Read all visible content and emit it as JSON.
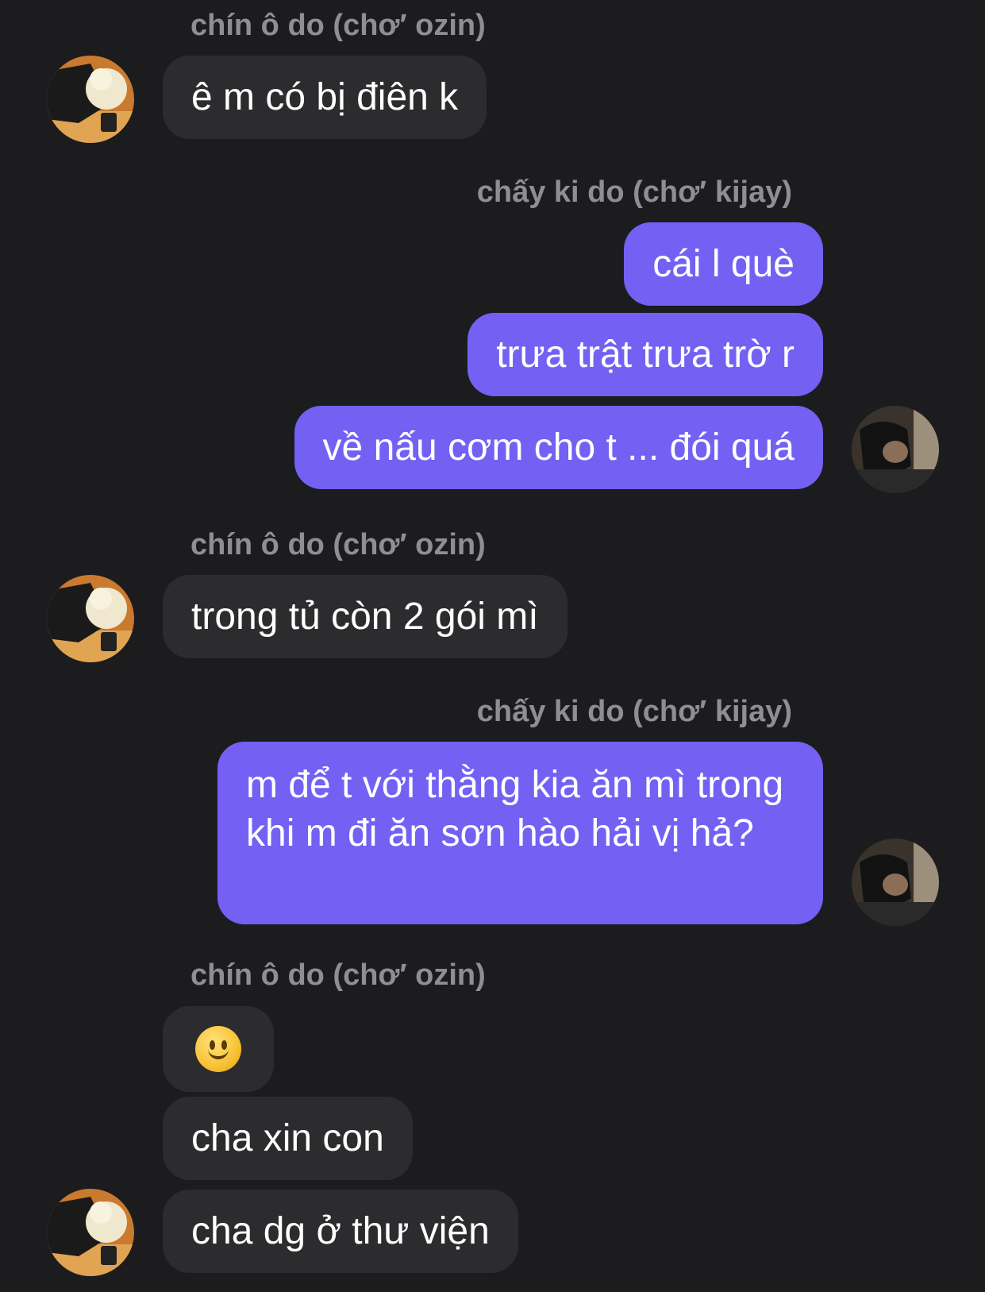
{
  "conversation": {
    "messages": [
      {
        "sender": "chín ô do (chơ′ ozin)",
        "text": "ê m có bị điên k"
      },
      {
        "sender": "chấy ki do (chơ′ kijay)",
        "text": "cái l què"
      },
      {
        "text": "trưa trật trưa trờ r"
      },
      {
        "text": "về nấu cơm cho t ... đói quá"
      },
      {
        "sender": "chín ô do (chơ′ ozin)",
        "text": "trong tủ còn 2 gói mì"
      },
      {
        "sender": "chấy ki do (chơ′ kijay)",
        "text": "m để t với thằng kia ăn mì trong khi m đi ăn sơn hào hải vị hả?"
      },
      {
        "sender": "chín ô do (chơ′ ozin)",
        "emoji": "slightly-smiling-face"
      },
      {
        "text": "cha xin con"
      },
      {
        "text": "cha dg ở thư viện"
      }
    ]
  },
  "colors": {
    "background": "#1c1c1e",
    "incoming_bubble": "#2c2c2e",
    "outgoing_bubble": "#7560f4",
    "sender_name": "#8e8e93",
    "message_text": "#ffffff"
  }
}
